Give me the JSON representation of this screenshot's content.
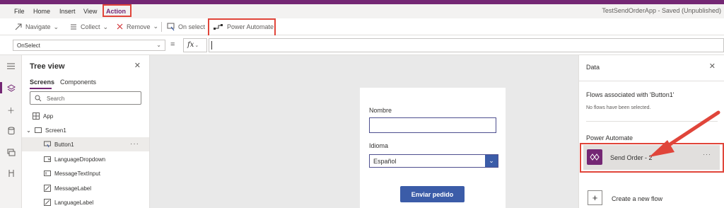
{
  "app": {
    "title": "TestSendOrderApp - Saved (Unpublished)"
  },
  "menu": {
    "items": [
      "File",
      "Home",
      "Insert",
      "View",
      "Action"
    ],
    "active": "Action"
  },
  "toolbar": {
    "navigate": "Navigate",
    "collect": "Collect",
    "remove": "Remove",
    "on_select": "On select",
    "power_automate": "Power Automate"
  },
  "formula": {
    "property": "OnSelect",
    "equals": "=",
    "fx": "fx",
    "value": ""
  },
  "tree": {
    "title": "Tree view",
    "tabs": [
      "Screens",
      "Components"
    ],
    "search_placeholder": "Search",
    "items": [
      {
        "label": "App",
        "icon": "app-icon",
        "level": 0
      },
      {
        "label": "Screen1",
        "icon": "screen-icon",
        "level": 0,
        "expanded": true
      },
      {
        "label": "Button1",
        "icon": "button-icon",
        "level": 1,
        "selected": true
      },
      {
        "label": "LanguageDropdown",
        "icon": "dropdown-icon",
        "level": 1
      },
      {
        "label": "MessageTextInput",
        "icon": "text-input-icon",
        "level": 1
      },
      {
        "label": "MessageLabel",
        "icon": "label-icon",
        "level": 1
      },
      {
        "label": "LanguageLabel",
        "icon": "label-icon",
        "level": 1
      }
    ]
  },
  "screen": {
    "name_label": "Nombre",
    "language_label": "Idioma",
    "language_value": "Español",
    "submit_label": "Enviar pedido"
  },
  "data_panel": {
    "title": "Data",
    "associated_title": "Flows associated with 'Button1'",
    "no_flows": "No flows have been selected.",
    "section_title": "Power Automate",
    "flow_name": "Send Order - 2",
    "create_label": "Create a new flow"
  },
  "colors": {
    "brand": "#742774",
    "annotation": "#e0453a",
    "button": "#3b5ca8"
  }
}
